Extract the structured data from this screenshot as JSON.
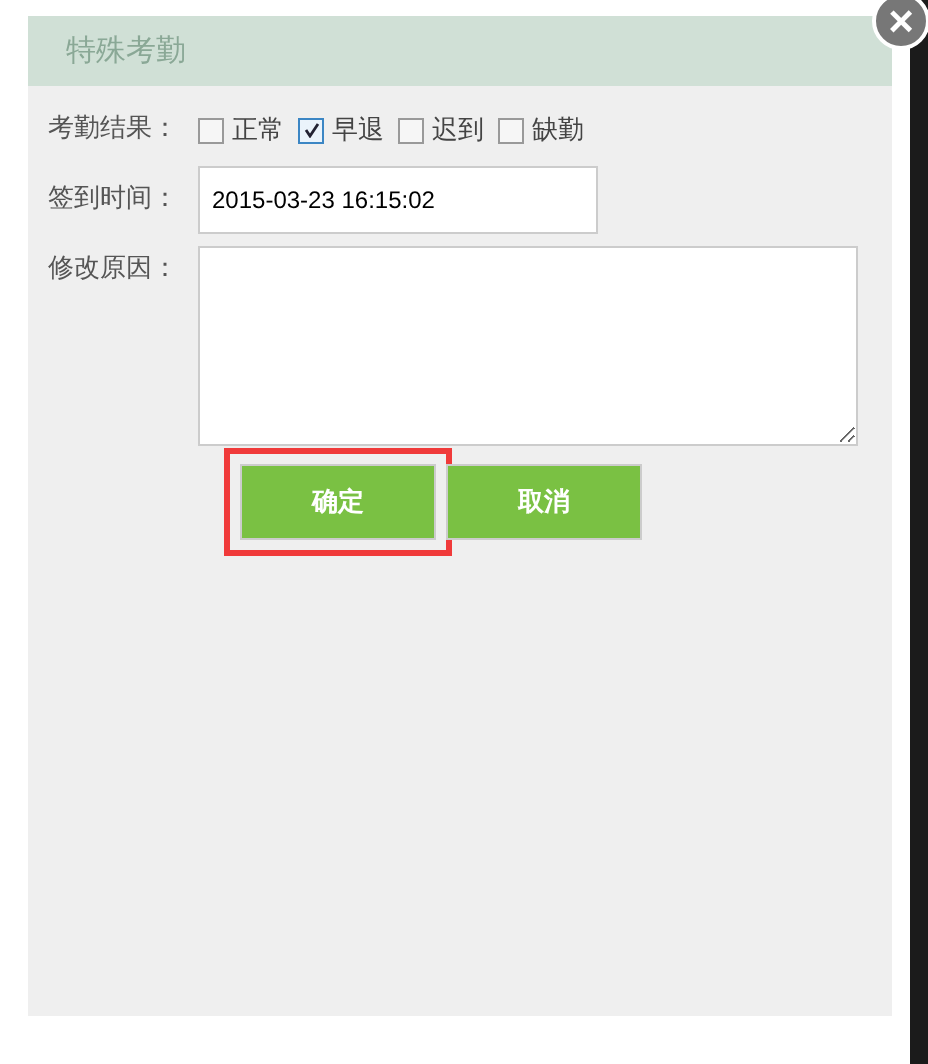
{
  "dialog": {
    "title": "特殊考勤",
    "close": "×"
  },
  "result": {
    "label": "考勤结果：",
    "options": [
      {
        "label": "正常",
        "checked": false
      },
      {
        "label": "早退",
        "checked": true
      },
      {
        "label": "迟到",
        "checked": false
      },
      {
        "label": "缺勤",
        "checked": false
      }
    ]
  },
  "sign_time": {
    "label": "签到时间：",
    "value": "2015-03-23 16:15:02"
  },
  "reason": {
    "label": "修改原因："
  },
  "buttons": [
    {
      "label": "确定",
      "highlighted": true
    },
    {
      "label": "取消",
      "highlighted": false
    }
  ]
}
